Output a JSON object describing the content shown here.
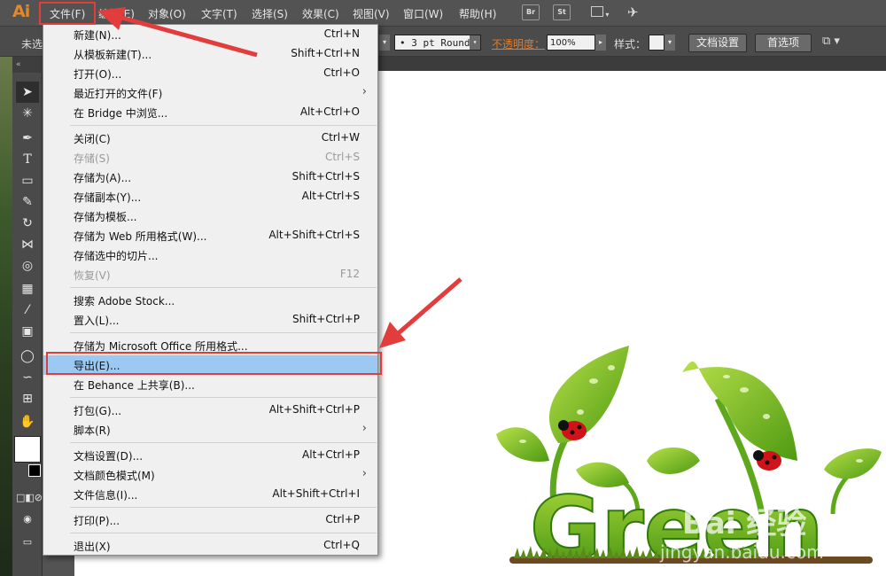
{
  "app": {
    "logo": "Ai"
  },
  "menubar": {
    "items": [
      "文件(F)",
      "编辑(E)",
      "对象(O)",
      "文字(T)",
      "选择(S)",
      "效果(C)",
      "视图(V)",
      "窗口(W)",
      "帮助(H)"
    ],
    "bridge_label": "Br",
    "stock_label": "St"
  },
  "controlbar": {
    "selection_text": "未选",
    "stroke_profile": "3 pt Round",
    "opacity_label": "不透明度：",
    "opacity_value": "100%",
    "style_label": "样式：",
    "doc_setup_button": "文档设置",
    "preferences_button": "首选项"
  },
  "file_menu": {
    "groups": [
      [
        {
          "label": "新建(N)...",
          "shortcut": "Ctrl+N"
        },
        {
          "label": "从模板新建(T)...",
          "shortcut": "Shift+Ctrl+N"
        },
        {
          "label": "打开(O)...",
          "shortcut": "Ctrl+O"
        },
        {
          "label": "最近打开的文件(F)",
          "shortcut": ""
        },
        {
          "label": "在 Bridge 中浏览...",
          "shortcut": "Alt+Ctrl+O"
        }
      ],
      [
        {
          "label": "关闭(C)",
          "shortcut": "Ctrl+W"
        },
        {
          "label": "存储(S)",
          "shortcut": "Ctrl+S"
        },
        {
          "label": "存储为(A)...",
          "shortcut": "Shift+Ctrl+S"
        },
        {
          "label": "存储副本(Y)...",
          "shortcut": "Alt+Ctrl+S"
        },
        {
          "label": "存储为模板...",
          "shortcut": ""
        },
        {
          "label": "存储为 Web 所用格式(W)...",
          "shortcut": "Alt+Shift+Ctrl+S"
        },
        {
          "label": "存储选中的切片...",
          "shortcut": ""
        },
        {
          "label": "恢复(V)",
          "shortcut": "F12"
        }
      ],
      [
        {
          "label": "搜索 Adobe Stock...",
          "shortcut": ""
        },
        {
          "label": "置入(L)...",
          "shortcut": "Shift+Ctrl+P"
        }
      ],
      [
        {
          "label": "存储为 Microsoft Office 所用格式...",
          "shortcut": ""
        },
        {
          "label": "导出(E)...",
          "shortcut": ""
        },
        {
          "label": "在 Behance 上共享(B)...",
          "shortcut": ""
        }
      ],
      [
        {
          "label": "打包(G)...",
          "shortcut": "Alt+Shift+Ctrl+P"
        },
        {
          "label": "脚本(R)",
          "shortcut": ""
        }
      ],
      [
        {
          "label": "文档设置(D)...",
          "shortcut": "Alt+Ctrl+P"
        },
        {
          "label": "文档颜色模式(M)",
          "shortcut": ""
        },
        {
          "label": "文件信息(I)...",
          "shortcut": "Alt+Shift+Ctrl+I"
        }
      ],
      [
        {
          "label": "打印(P)...",
          "shortcut": "Ctrl+P"
        }
      ],
      [
        {
          "label": "退出(X)",
          "shortcut": "Ctrl+Q"
        }
      ]
    ]
  },
  "artwork": {
    "word": "Green"
  },
  "watermark": {
    "brand": "Bai 经验",
    "url": "jingyan.baidu.com"
  }
}
